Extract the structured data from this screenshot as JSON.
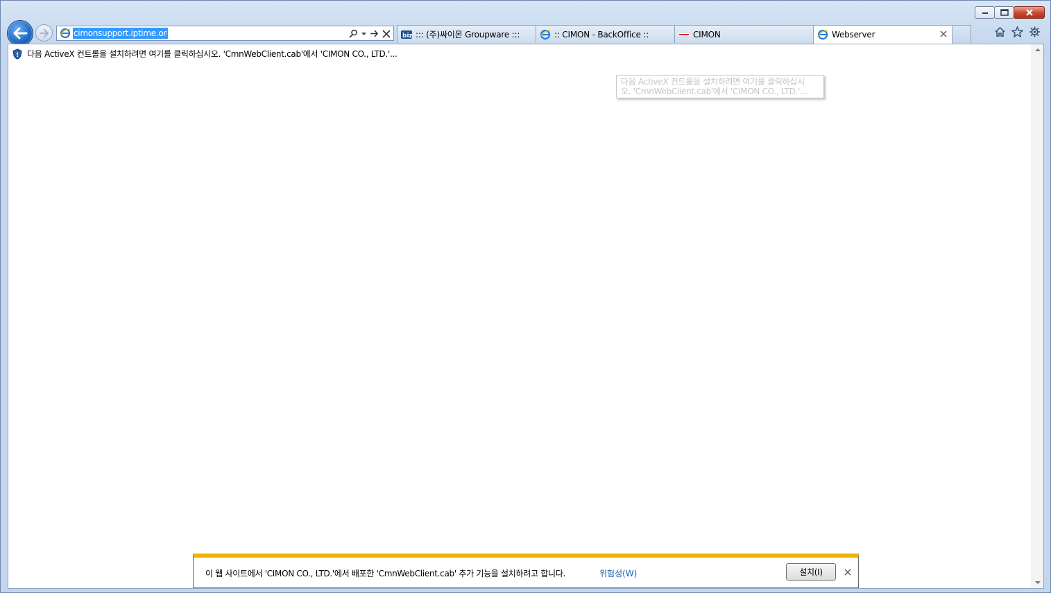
{
  "address_bar": {
    "url": "cimonsupport.iptime.org"
  },
  "tabs": [
    {
      "label": "::: (주)싸이몬 Groupware :::"
    },
    {
      "label": ":: CIMON - BackOffice ::"
    },
    {
      "label": "CIMON"
    },
    {
      "label": "Webserver"
    }
  ],
  "infobar": {
    "text": "다음 ActiveX 컨트롤을 설치하려면 여기를 클릭하십시오. 'CmnWebClient.cab'에서 'CIMON CO., LTD.'..."
  },
  "tooltip": {
    "line1": "다음 ActiveX 컨트롤을 설치하려면 여기를 클릭하십시",
    "line2": "오. 'CmnWebClient.cab'에서 'CIMON CO., LTD.'..."
  },
  "notification": {
    "text": "이 웹 사이트에서 'CIMON CO., LTD.'에서 배포한 'CmnWebClient.cab' 추가 기능을 설치하려고 합니다.",
    "risk_link": "위험성(W)",
    "install_label": "설치(I)"
  },
  "colors": {
    "accent": "#f0b400",
    "link": "#1a5fb4",
    "selection": "#3399ff"
  }
}
